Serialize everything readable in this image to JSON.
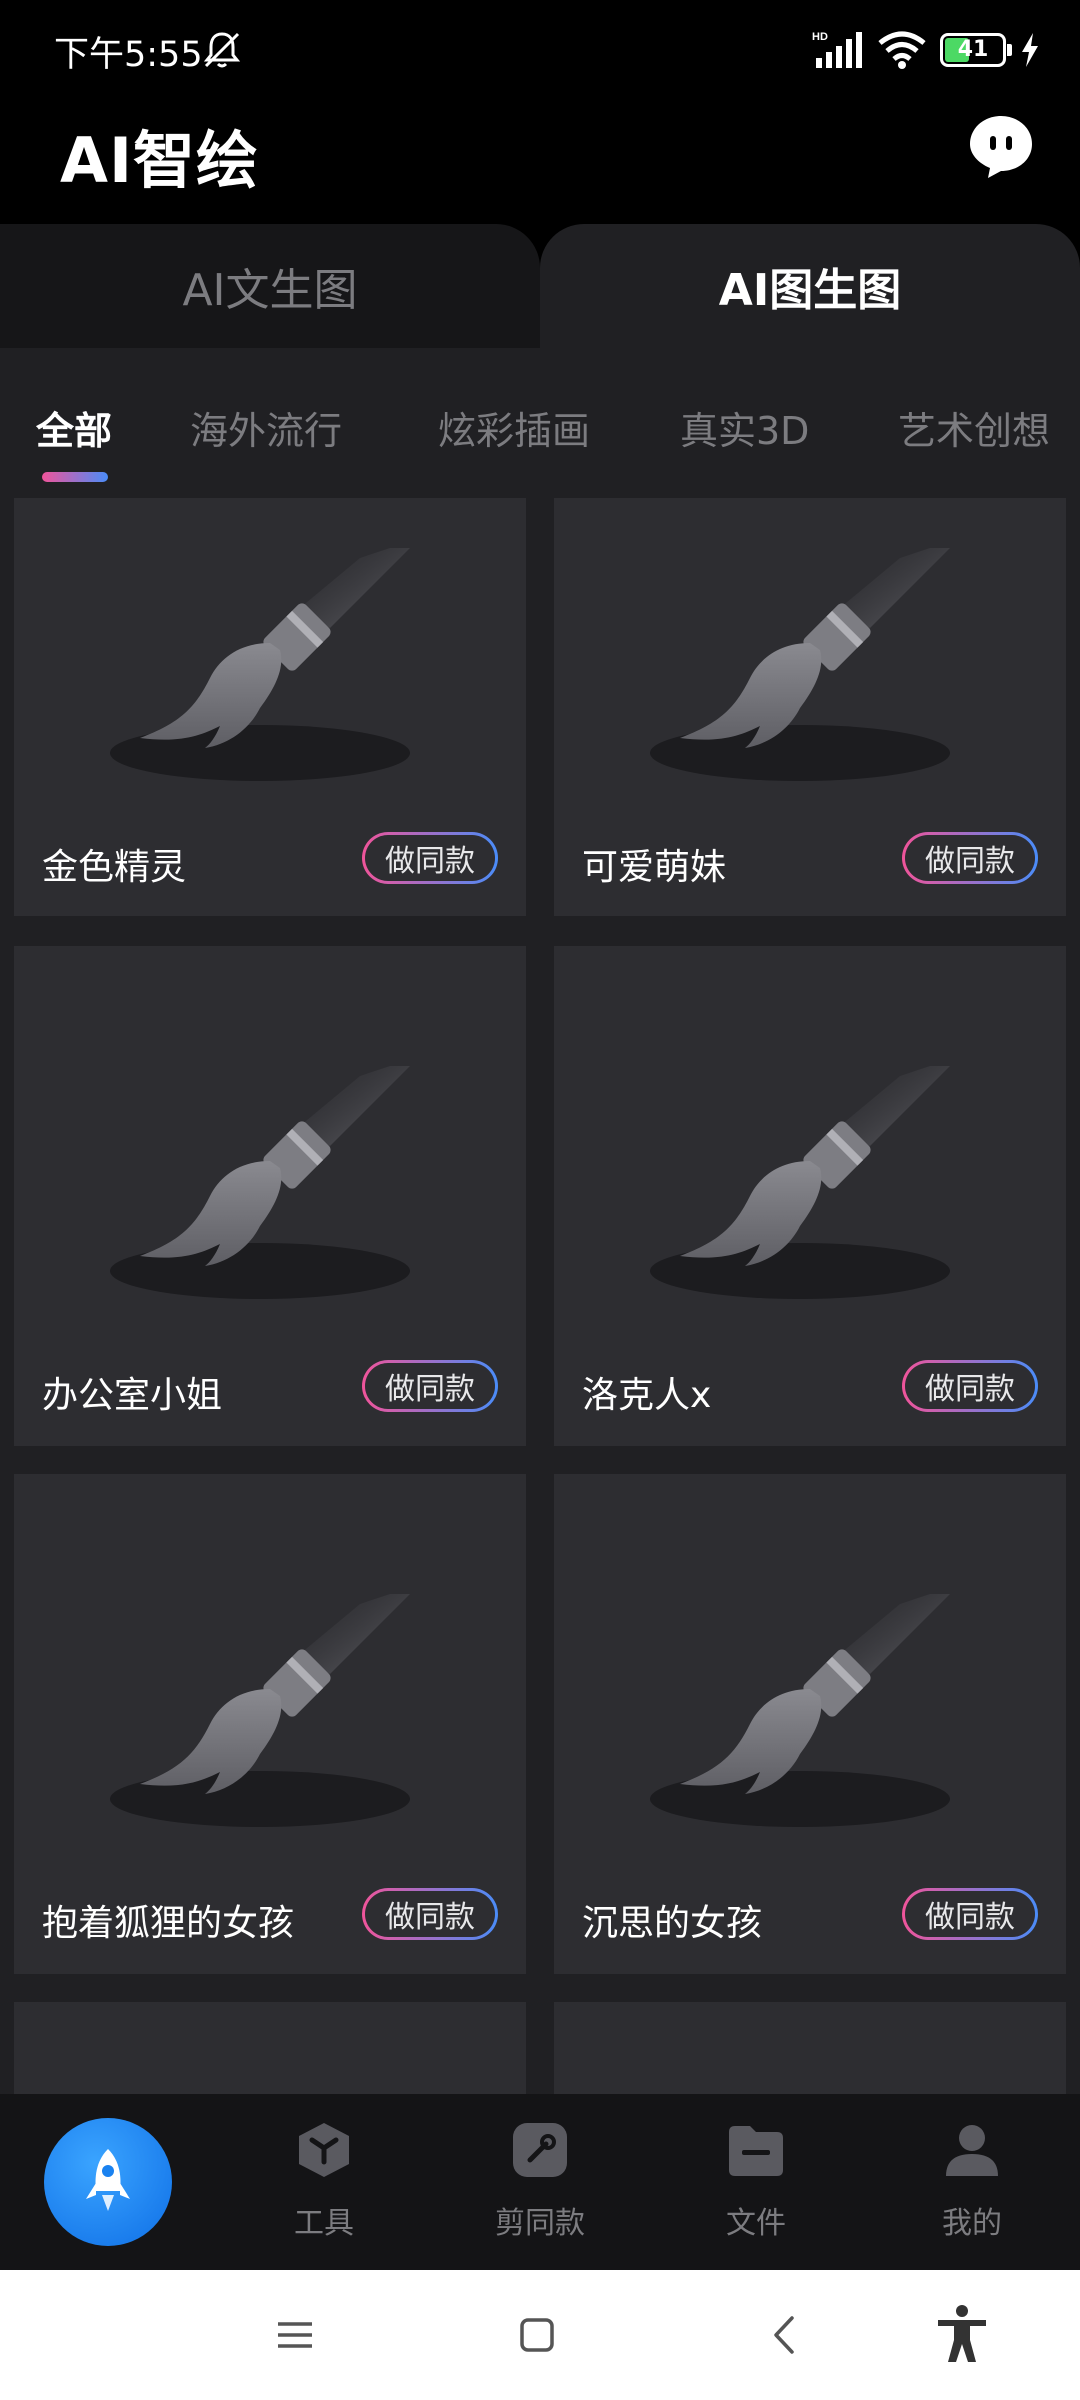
{
  "status_bar": {
    "time": "下午5:55",
    "battery": "41"
  },
  "header": {
    "title": "AI智绘"
  },
  "mode_tabs": [
    "AI文生图",
    "AI图生图"
  ],
  "categories": [
    "全部",
    "海外流行",
    "炫彩插画",
    "真实3D",
    "艺术创想"
  ],
  "cards": [
    {
      "title": "金色精灵",
      "button": "做同款"
    },
    {
      "title": "可爱萌妹",
      "button": "做同款"
    },
    {
      "title": "办公室小姐",
      "button": "做同款"
    },
    {
      "title": "洛克人x",
      "button": "做同款"
    },
    {
      "title": "抱着狐狸的女孩",
      "button": "做同款"
    },
    {
      "title": "沉思的女孩",
      "button": "做同款"
    }
  ],
  "bottom_nav": [
    {
      "label": "工具",
      "icon": "cube-icon"
    },
    {
      "label": "剪同款",
      "icon": "edit-icon"
    },
    {
      "label": "文件",
      "icon": "folder-icon"
    },
    {
      "label": "我的",
      "icon": "person-icon"
    }
  ],
  "colors": {
    "background": "#000000",
    "panel": "#202023",
    "card": "#2d2d31",
    "accent_pink": "#f0549a",
    "accent_blue": "#4a8cf8",
    "fab_blue": "#1a82f0"
  }
}
